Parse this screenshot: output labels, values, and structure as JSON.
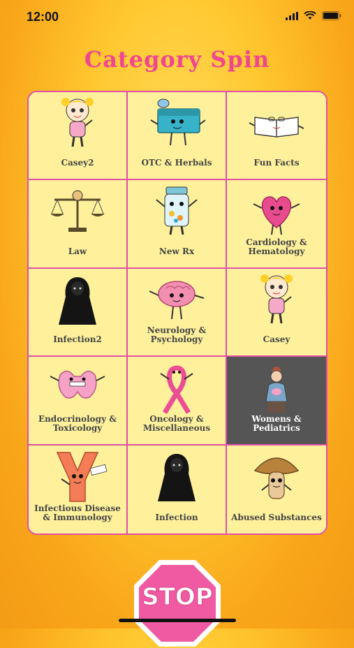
{
  "status": {
    "time": "12:00"
  },
  "title": "Category Spin",
  "categories": [
    {
      "label": "Casey2",
      "icon": "girl-character-icon"
    },
    {
      "label": "OTC & Herbals",
      "icon": "medicine-box-icon"
    },
    {
      "label": "Fun Facts",
      "icon": "open-book-icon"
    },
    {
      "label": "Law",
      "icon": "scales-of-justice-icon"
    },
    {
      "label": "New Rx",
      "icon": "pill-bottle-icon"
    },
    {
      "label": "Cardiology & Hematology",
      "icon": "heart-character-icon"
    },
    {
      "label": "Infection2",
      "icon": "grim-reaper-icon"
    },
    {
      "label": "Neurology & Psychology",
      "icon": "brain-character-icon"
    },
    {
      "label": "Casey",
      "icon": "girl-character-icon"
    },
    {
      "label": "Endocrinology & Toxicology",
      "icon": "thyroid-character-icon"
    },
    {
      "label": "Oncology & Miscellaneous",
      "icon": "pink-ribbon-icon"
    },
    {
      "label": "Womens & Pediatrics",
      "icon": "mother-baby-icon",
      "selected": true
    },
    {
      "label": "Infectious Disease & Immunology",
      "icon": "antibody-character-icon"
    },
    {
      "label": "Infection",
      "icon": "grim-reaper-icon"
    },
    {
      "label": "Abused Substances",
      "icon": "mushroom-character-icon"
    }
  ],
  "stop_button": {
    "label": "STOP"
  },
  "colors": {
    "accent": "#f0468f",
    "border": "#e04fa8",
    "tile": "#fff19c",
    "selected_tile": "#555555"
  }
}
